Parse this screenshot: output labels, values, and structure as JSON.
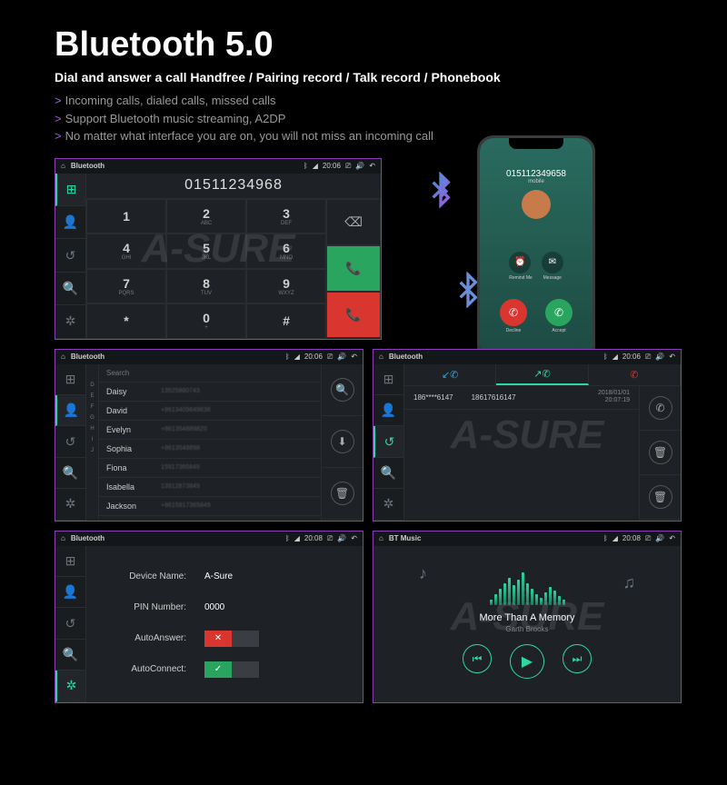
{
  "header": {
    "title": "Bluetooth 5.0",
    "subtitle": "Dial and answer a call Handfree / Pairing record / Talk record / Phonebook",
    "bullets": [
      "Incoming calls, dialed calls, missed calls",
      "Support Bluetooth music streaming, A2DP",
      "No matter what interface you are on, you will not miss an incoming call"
    ]
  },
  "watermark": "A-SURE",
  "statusbar": {
    "bt_label": "Bluetooth",
    "music_label": "BT Music",
    "time_dialer": "20:06",
    "time_contacts": "20:06",
    "time_calllog": "20:06",
    "time_settings": "20:08",
    "time_music": "20:08"
  },
  "dialer": {
    "display": "01511234968",
    "keys": [
      {
        "num": "1",
        "sub": ""
      },
      {
        "num": "2",
        "sub": "ABC"
      },
      {
        "num": "3",
        "sub": "DEF"
      },
      {
        "num": "4",
        "sub": "GHI"
      },
      {
        "num": "5",
        "sub": "JKL"
      },
      {
        "num": "6",
        "sub": "MNO"
      },
      {
        "num": "7",
        "sub": "PQRS"
      },
      {
        "num": "8",
        "sub": "TUV"
      },
      {
        "num": "9",
        "sub": "WXYZ"
      },
      {
        "num": "*",
        "sub": ""
      },
      {
        "num": "0",
        "sub": "+"
      },
      {
        "num": "#",
        "sub": ""
      }
    ]
  },
  "phone": {
    "number": "015112349658",
    "label": "mobile",
    "opt_remind": "Remind Me",
    "opt_message": "Message",
    "decline": "Decline",
    "accept": "Accept"
  },
  "contacts": {
    "search": "Search",
    "list": [
      {
        "letter": "",
        "name": "Daisy",
        "number": "13525880743"
      },
      {
        "letter": "",
        "name": "David",
        "number": "+8613409849838"
      },
      {
        "letter": "E",
        "name": "Evelyn",
        "number": "+861354889820"
      },
      {
        "letter": "F",
        "name": "Sophia",
        "number": "+8613548898"
      },
      {
        "letter": "",
        "name": "Fiona",
        "number": "15917365849"
      },
      {
        "letter": "",
        "name": "Isabella",
        "number": "13912873849"
      },
      {
        "letter": "",
        "name": "Jackson",
        "number": "+8615917365849"
      }
    ],
    "letters": [
      "D",
      "E",
      "F",
      "G",
      "H",
      "I",
      "J"
    ]
  },
  "calllog": {
    "entries": [
      {
        "num1": "186****6147",
        "num2": "18617616147",
        "date": "2018/01/01",
        "time": "20:07:19"
      }
    ]
  },
  "settings": {
    "device_name_label": "Device Name:",
    "device_name_value": "A-Sure",
    "pin_label": "PIN Number:",
    "pin_value": "0000",
    "auto_answer_label": "AutoAnswer:",
    "auto_connect_label": "AutoConnect:"
  },
  "music": {
    "title": "More Than A Memory",
    "artist": "Garth Brooks"
  },
  "viz_heights": [
    6,
    12,
    18,
    24,
    30,
    22,
    28,
    36,
    24,
    18,
    12,
    8,
    14,
    20,
    16,
    10,
    6
  ]
}
